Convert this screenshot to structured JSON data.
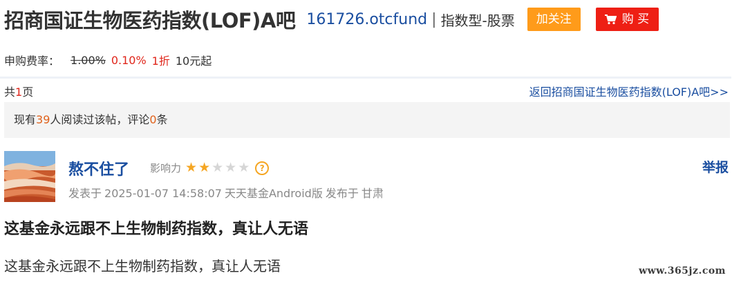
{
  "header": {
    "bar_title": "招商国证生物医药指数(LOF)A吧",
    "fund_code": "161726.otcfund",
    "separator": "|",
    "fund_type": "指数型-股票",
    "follow_label": "加关注",
    "buy_label": "购 买"
  },
  "fee": {
    "label": "申购费率：",
    "original": "1.00%",
    "current": "0.10%",
    "discount": "1折",
    "minimum": "10元起"
  },
  "pagination": {
    "prefix": "共",
    "count": "1",
    "suffix": "页",
    "back_link": "返回招商国证生物医药指数(LOF)A吧>>"
  },
  "stats": {
    "prefix": "现有",
    "readers": "39",
    "middle": "人阅读过该帖，评论",
    "comments": "0",
    "suffix": "条"
  },
  "post": {
    "author": "熬不住了",
    "influence_label": "影响力",
    "influence_stars": 2,
    "influence_max": 5,
    "help_icon": "?",
    "report_label": "举报",
    "meta": {
      "posted_prefix": "发表于",
      "datetime": "2025-01-07 14:58:07",
      "client": "天天基金Android版",
      "location_prefix": "发布于",
      "location": "甘肃"
    },
    "title": "这基金永远跟不上生物制药指数，真让人无语",
    "body": "这基金永远跟不上生物制药指数，真让人无语"
  },
  "watermark": "www.365jz.com",
  "colors": {
    "link_blue": "#1a4ea0",
    "follow_orange": "#ff9b1a",
    "buy_red": "#ee1f14",
    "price_red": "#e0261b",
    "star_gold": "#f5a623"
  },
  "icons": {
    "buy": "cart-icon",
    "help": "question-circle-icon",
    "stars": "star-icon"
  }
}
